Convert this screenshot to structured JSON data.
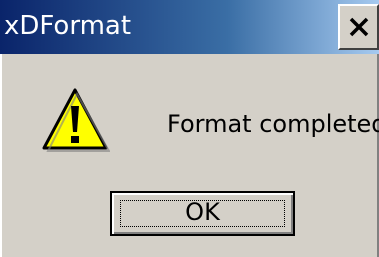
{
  "window": {
    "title": "xDFormat",
    "close_glyph": "X"
  },
  "dialog": {
    "icon": "warning-icon",
    "message": "Format completed."
  },
  "buttons": {
    "ok_label": "OK"
  },
  "colors": {
    "titlebar_start": "#0a246a",
    "titlebar_end": "#a6caf0",
    "dialog_bg": "#d4d0c8",
    "warning_yellow": "#ffff00"
  }
}
